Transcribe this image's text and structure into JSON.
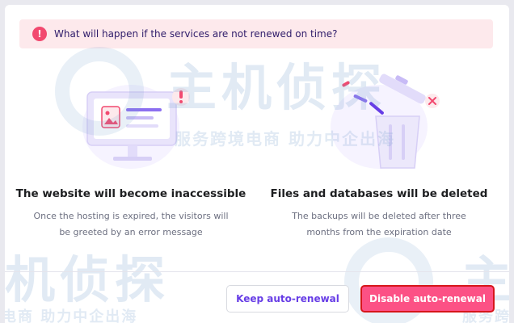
{
  "alert": {
    "icon": "exclamation-icon",
    "text": "What will happen if the services are not renewed on time?"
  },
  "columns": [
    {
      "illustration": "browser-window-illustration",
      "title": "The website will become inaccessible",
      "description": "Once the hosting is expired, the visitors will be greeted by an error message"
    },
    {
      "illustration": "trash-bin-illustration",
      "title": "Files and databases will be deleted",
      "description": "The backups will be deleted after three months from the expiration date"
    }
  ],
  "footer": {
    "keep_label": "Keep auto-renewal",
    "disable_label": "Disable auto-renewal"
  },
  "watermark": {
    "brand": "主机侦探",
    "slogan": "服务跨境电商 助力中企出海",
    "slogan_partial_left": "电商 助力中企出海",
    "brand_partial_left": "机侦探",
    "slogan_partial_right": "服务跨",
    "brand_partial_right": "主"
  },
  "colors": {
    "accent": "#673de6",
    "danger": "#fc5185",
    "alert_bg": "#fde9ec",
    "alert_icon": "#f2496f"
  }
}
